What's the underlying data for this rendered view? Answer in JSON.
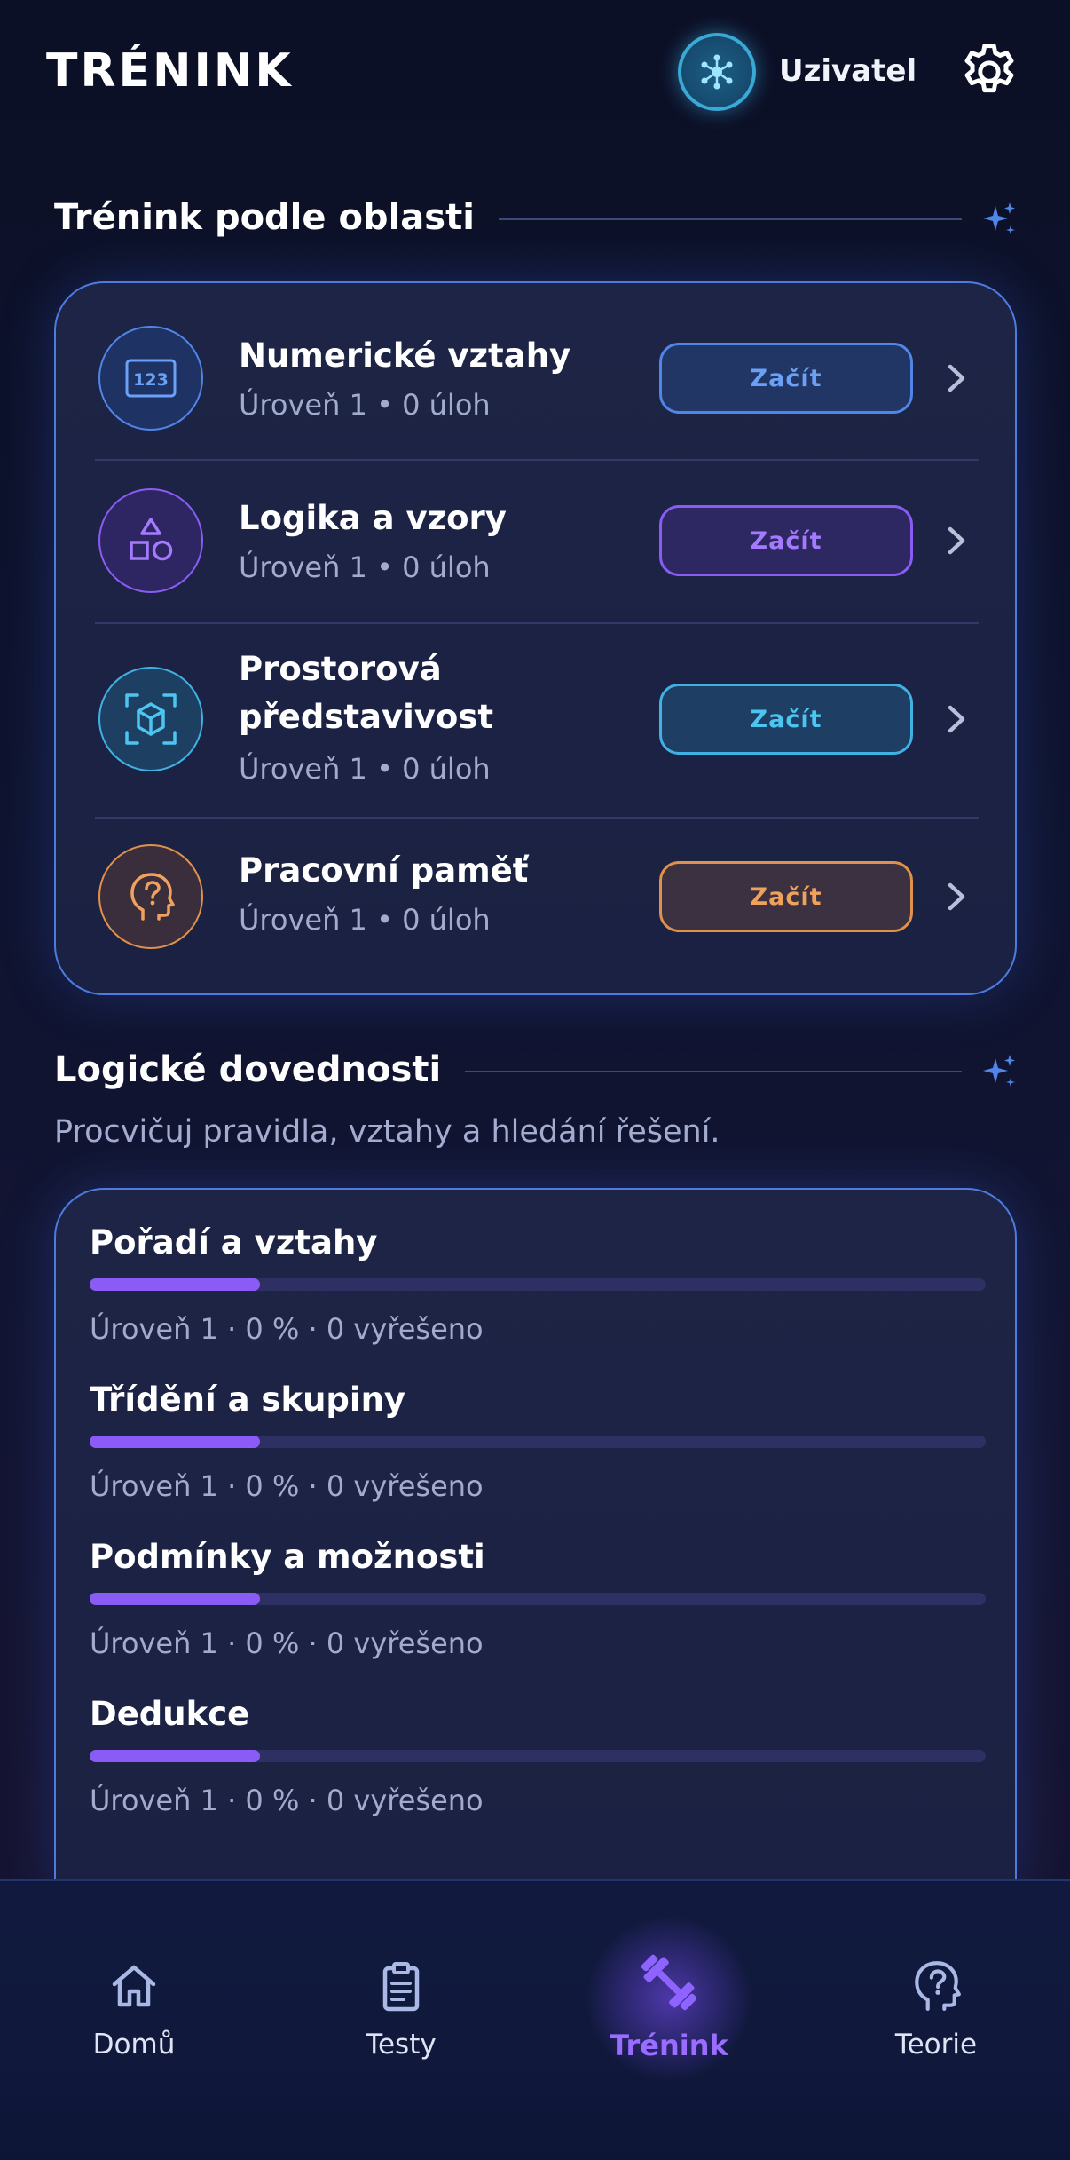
{
  "header": {
    "title": "TRÉNINK",
    "user_name": "Uzivatel"
  },
  "areas_section": {
    "title": "Trénink podle oblasti",
    "items": [
      {
        "title_line1": "Numerické vztahy",
        "title_line2": "",
        "subtitle": "Úroveň 1 • 0 úloh",
        "button": "Začít",
        "icon": "numbers-123-icon",
        "color": "#4f86e8"
      },
      {
        "title_line1": "Logika a vzory",
        "title_line2": "",
        "subtitle": "Úroveň 1 • 0 úloh",
        "button": "Začít",
        "icon": "shapes-icon",
        "color": "#8a5cf5"
      },
      {
        "title_line1": "Prostorová",
        "title_line2": "představivost",
        "subtitle": "Úroveň 1 • 0 úloh",
        "button": "Začít",
        "icon": "cube-scan-icon",
        "color": "#3fb2e3"
      },
      {
        "title_line1": "Pracovní paměť",
        "title_line2": "",
        "subtitle": "Úroveň 1 • 0 úloh",
        "button": "Začít",
        "icon": "head-question-icon",
        "color": "#e0914a"
      }
    ]
  },
  "skills_section": {
    "title": "Logické dovednosti",
    "subtitle": "Procvičuj pravidla, vztahy a hledání řešení.",
    "items": [
      {
        "title": "Pořadí a vztahy",
        "subtitle": "Úroveň 1 · 0 % · 0 vyřešeno",
        "progress": 0.19
      },
      {
        "title": "Třídění a skupiny",
        "subtitle": "Úroveň 1 · 0 % · 0 vyřešeno",
        "progress": 0.19
      },
      {
        "title": "Podmínky a možnosti",
        "subtitle": "Úroveň 1 · 0 % · 0 vyřešeno",
        "progress": 0.19
      },
      {
        "title": "Dedukce",
        "subtitle": "Úroveň 1 · 0 % · 0 vyřešeno",
        "progress": 0.19
      }
    ]
  },
  "nav": {
    "items": [
      {
        "label": "Domů",
        "icon": "home-icon",
        "active": false
      },
      {
        "label": "Testy",
        "icon": "clipboard-icon",
        "active": false
      },
      {
        "label": "Trénink",
        "icon": "dumbbell-icon",
        "active": true
      },
      {
        "label": "Teorie",
        "icon": "head-question-icon",
        "active": false
      }
    ]
  },
  "colors": {
    "accent": "#8a5cf5",
    "blue": "#4f86e8",
    "cyan": "#3fb2e3",
    "orange": "#e0914a"
  }
}
